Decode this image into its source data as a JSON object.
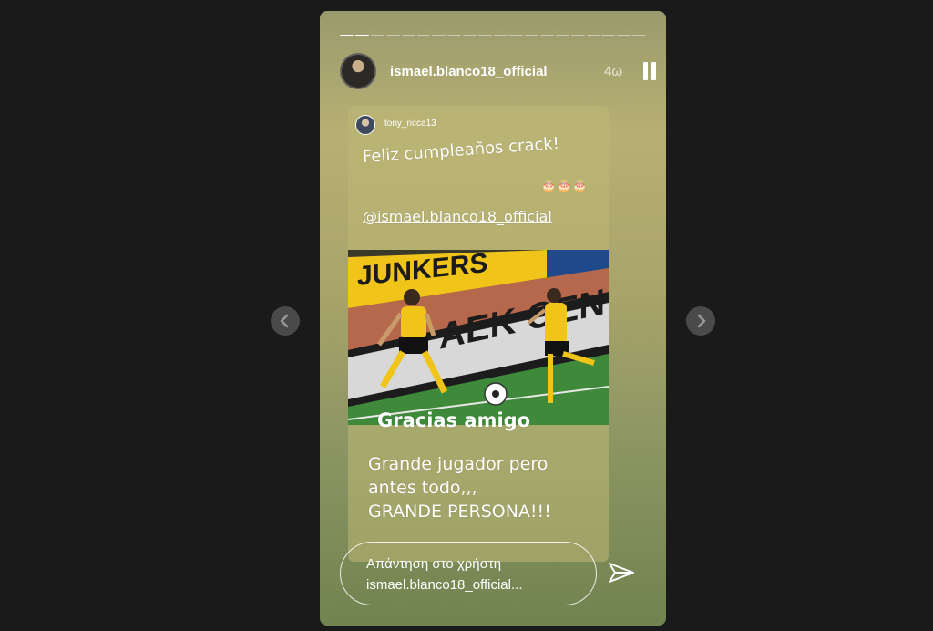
{
  "story": {
    "progress_segments": 20,
    "progress_done": 2,
    "username": "ismael.blanco18_official",
    "time_ago": "4ω",
    "icons": {
      "pause": "pause-icon",
      "mute": "volume-mute-icon",
      "more": "more-options-icon",
      "send": "send-icon",
      "prev": "chevron-left-icon",
      "next": "chevron-right-icon"
    }
  },
  "repost": {
    "username": "tony_ricca13",
    "greeting": "Feliz cumpleaños crack!",
    "cakes": "🎂🎂🎂",
    "mention": "@ismael.blanco18_official",
    "photo_banner_top": "JUNKERS",
    "photo_banner_mid": "AEK ΘΕΝ",
    "caption_main": "Gracias amigo",
    "caption_lines": [
      "Grande jugador pero",
      "antes todo,,,",
      "GRANDE PERSONA!!!"
    ]
  },
  "reply": {
    "line1": "Απάντηση στο χρήστη",
    "line2": "ismael.blanco18_official..."
  }
}
